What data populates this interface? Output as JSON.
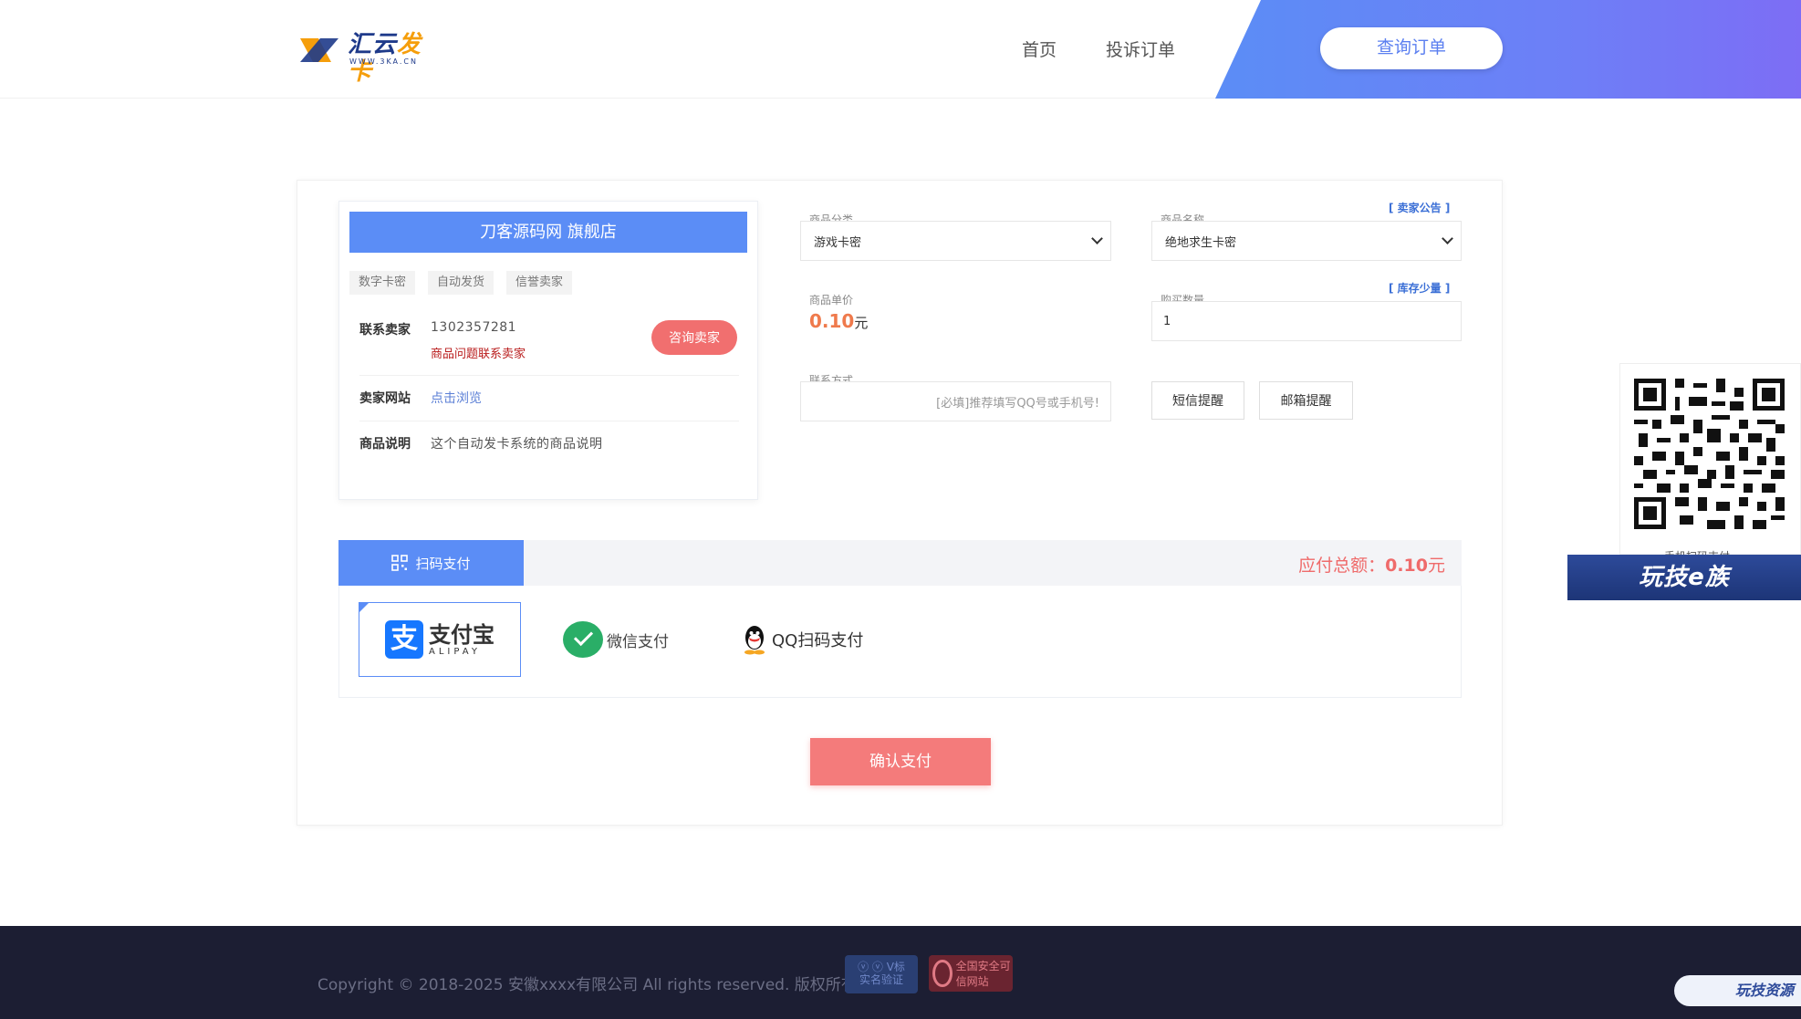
{
  "header": {
    "logo_text_main": "汇云",
    "logo_text_accent": "发卡",
    "logo_sub": "WWW.3KA.CN",
    "nav": {
      "home": "首页",
      "complain": "投诉订单"
    },
    "query_button": "查询订单"
  },
  "seller": {
    "shop_title": "刀客源码网 旗舰店",
    "tags": [
      "数字卡密",
      "自动发货",
      "信誉卖家"
    ],
    "contact_label": "联系卖家",
    "contact_value": "1302357281",
    "contact_hint": "商品问题联系卖家",
    "ask_button": "咨询卖家",
    "site_label": "卖家网站",
    "site_link": "点击浏览",
    "desc_label": "商品说明",
    "desc_value": "这个自动发卡系统的商品说明"
  },
  "form": {
    "category_label": "商品分类",
    "category_value": "游戏卡密",
    "notice_link": "[ 卖家公告 ]",
    "name_label": "商品名称",
    "name_value": "绝地求生卡密",
    "price_label": "商品单价",
    "price_value": "0.10",
    "price_unit": "元",
    "stock_link": "[ 库存少量 ]",
    "qty_label": "购买数量",
    "qty_value": "1",
    "contact_label": "联系方式",
    "contact_placeholder": "[必填]推荐填写QQ号或手机号!",
    "sms_button": "短信提醒",
    "email_button": "邮箱提醒"
  },
  "payment": {
    "tab_label": "扫码支付",
    "total_label": "应付总额：",
    "total_value": "0.10",
    "total_unit": "元",
    "methods": {
      "alipay_cn": "支付宝",
      "alipay_en": "ALIPAY",
      "wechat": "微信支付",
      "qq": "QQ扫码支付"
    },
    "confirm_button": "确认支付"
  },
  "side": {
    "qr_caption": "手机扫码支付",
    "brand_banner": "玩技e族"
  },
  "footer": {
    "copyright": "Copyright © 2018-2025 安徽xxxx有限公司 All rights reserved. 版权所有",
    "badge1_line1": "ⓥ ⓥ V标",
    "badge1_line2": "实名验证",
    "badge2": "全国安全可信网站",
    "brand": "玩技资源"
  },
  "colors": {
    "primary": "#5b8df6",
    "accent_red": "#f47b7b",
    "price_orange": "#ef7a4c",
    "footer_bg": "#1c1e33"
  },
  "icons": [
    "logo-mark-icon",
    "chevron-down-icon",
    "qr-grid-icon",
    "alipay-icon",
    "wechat-icon",
    "qq-penguin-icon",
    "qr-code-icon",
    "shield-badge-icon"
  ]
}
